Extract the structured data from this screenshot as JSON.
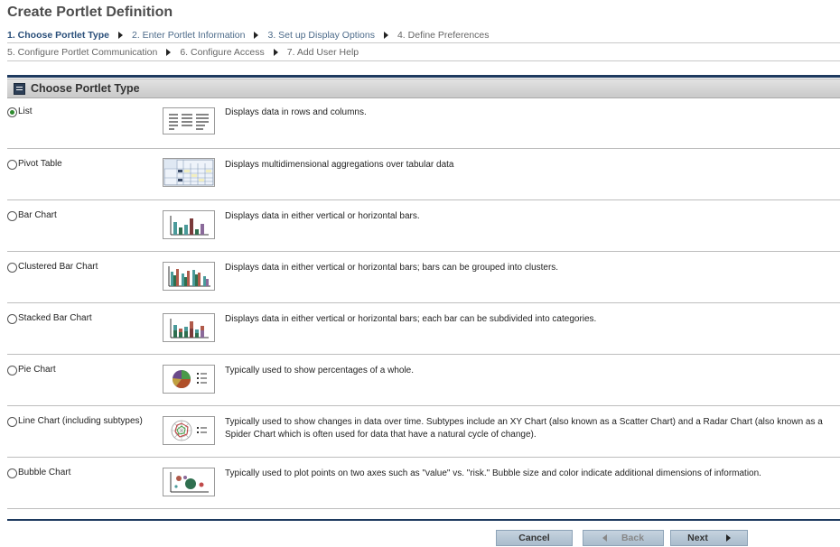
{
  "page": {
    "title": "Create Portlet Definition"
  },
  "steps": {
    "row1": [
      {
        "label": "1. Choose Portlet Type",
        "state": "active"
      },
      {
        "label": "2. Enter Portlet Information",
        "state": "link"
      },
      {
        "label": "3. Set up Display Options",
        "state": "link"
      },
      {
        "label": "4. Define Preferences",
        "state": "muted"
      }
    ],
    "row2": [
      {
        "label": "5. Configure Portlet Communication",
        "state": "muted"
      },
      {
        "label": "6. Configure Access",
        "state": "muted"
      },
      {
        "label": "7. Add User Help",
        "state": "muted"
      }
    ]
  },
  "section": {
    "title": "Choose Portlet Type"
  },
  "options": [
    {
      "label": "List",
      "description": "Displays data in rows and columns.",
      "selected": true,
      "icon": "list-thumbnail-icon"
    },
    {
      "label": "Pivot Table",
      "description": "Displays multidimensional aggregations over tabular data",
      "selected": false,
      "icon": "pivot-table-thumbnail-icon"
    },
    {
      "label": "Bar Chart",
      "description": "Displays data in either vertical or horizontal bars.",
      "selected": false,
      "icon": "bar-chart-thumbnail-icon"
    },
    {
      "label": "Clustered Bar Chart",
      "description": "Displays data in either vertical or horizontal bars; bars can be grouped into clusters.",
      "selected": false,
      "icon": "clustered-bar-chart-thumbnail-icon"
    },
    {
      "label": "Stacked Bar Chart",
      "description": "Displays data in either vertical or horizontal bars; each bar can be subdivided into categories.",
      "selected": false,
      "icon": "stacked-bar-chart-thumbnail-icon"
    },
    {
      "label": "Pie Chart",
      "description": "Typically used to show percentages of a whole.",
      "selected": false,
      "icon": "pie-chart-thumbnail-icon"
    },
    {
      "label": "Line Chart (including subtypes)",
      "description": "Typically used to show changes in data over time. Subtypes include an XY Chart (also known as a Scatter Chart) and a Radar Chart (also known as a Spider Chart which is often used for data that have a natural cycle of change).",
      "selected": false,
      "icon": "line-chart-thumbnail-icon"
    },
    {
      "label": "Bubble Chart",
      "description": "Typically used to plot points on two axes such as \"value\" vs. \"risk.\" Bubble size and color indicate additional dimensions of information.",
      "selected": false,
      "icon": "bubble-chart-thumbnail-icon"
    }
  ],
  "buttons": {
    "cancel": "Cancel",
    "back": "Back",
    "next": "Next"
  },
  "colors": {
    "accent": "#1e3a5f",
    "selected_radio": "#2d8a2d",
    "button": "#b8c8d6"
  }
}
